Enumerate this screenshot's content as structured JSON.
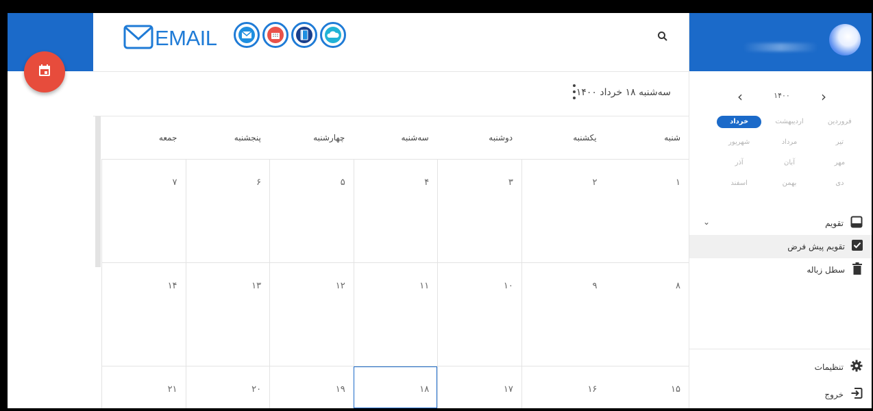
{
  "header": {
    "logo_text": "EMAIL",
    "apps": [
      "mail-app-icon",
      "calendar-app-icon",
      "contacts-app-icon",
      "cloud-app-icon"
    ],
    "search_icon": "search-icon"
  },
  "fab": {
    "icon": "calendar-icon"
  },
  "date_bar": {
    "current_date": "سه‌شنبه ۱۸ خرداد ۱۴۰۰"
  },
  "calendar": {
    "weekdays": [
      "شنبه",
      "یکشنبه",
      "دوشنبه",
      "سه‌شنبه",
      "چهارشنبه",
      "پنجشنبه",
      "جمعه"
    ],
    "weeks": [
      [
        "۱",
        "۲",
        "۳",
        "۴",
        "۵",
        "۶",
        "۷"
      ],
      [
        "۸",
        "۹",
        "۱۰",
        "۱۱",
        "۱۲",
        "۱۳",
        "۱۴"
      ],
      [
        "۱۵",
        "۱۶",
        "۱۷",
        "۱۸",
        "۱۹",
        "۲۰",
        "۲۱"
      ]
    ],
    "today": "۱۸"
  },
  "sidebar": {
    "year": "۱۴۰۰",
    "months": [
      "فروردین",
      "اردیبهشت",
      "خرداد",
      "تیر",
      "مرداد",
      "شهریور",
      "مهر",
      "آبان",
      "آذر",
      "دی",
      "بهمن",
      "اسفند"
    ],
    "selected_month": "خرداد",
    "menu": {
      "calendar": "تقویم",
      "default_calendar": "تقویم پیش فرض",
      "trash": "سطل زباله"
    },
    "bottom": {
      "settings": "تنظیمات",
      "logout": "خروج"
    }
  },
  "colors": {
    "brand_blue": "#1b6ac9",
    "fab_red": "#e74c3c"
  }
}
